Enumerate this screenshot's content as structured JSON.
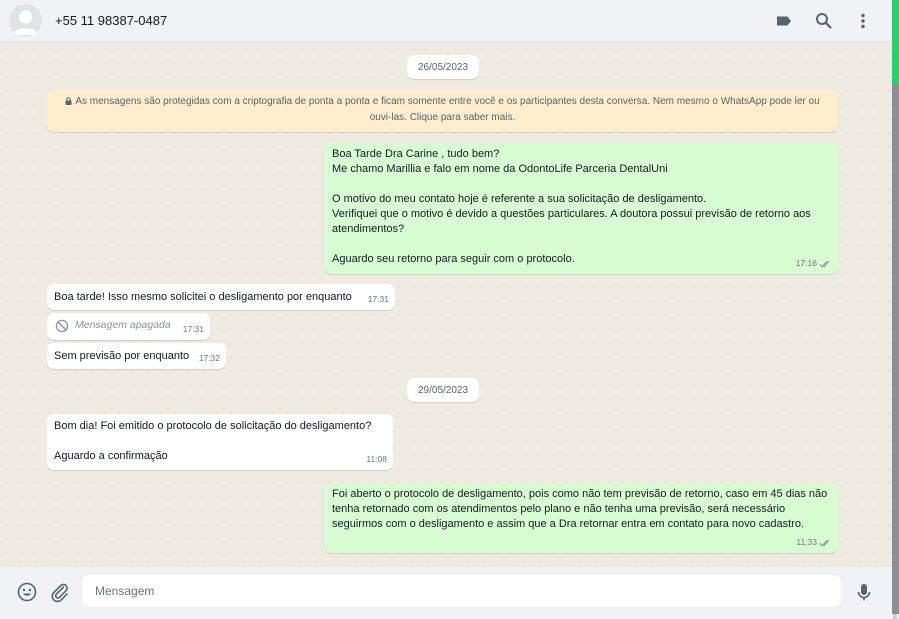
{
  "header": {
    "contact": "+55 11 98387-0487",
    "icons": [
      "label-icon",
      "search-icon",
      "menu-icon"
    ]
  },
  "chat": {
    "date1": "26/05/2023",
    "encryption_notice": "As mensagens são protegidas com a criptografia de ponta a ponta e ficam somente entre você e os participantes desta conversa. Nem mesmo o WhatsApp pode ler ou ouvi-las. Clique para saber mais.",
    "messages": [
      {
        "direction": "out",
        "text": "Boa Tarde Dra Carine , tudo bem?\nMe chamo Marillia e falo em nome da OdontoLife Parceria DentalUni\n\nO motivo do meu contato hoje é referente a sua solicitação de desligamento.\nVerifiquei que o motivo é devido a questões particulares. A doutora possui previsão de retorno aos atendimentos?\n\nAguardo seu retorno para seguir com o protocolo.",
        "time": "17:16",
        "status": "read"
      },
      {
        "direction": "in",
        "text": "Boa tarde! Isso mesmo solicitei o desligamento por enquanto",
        "time": "17:31"
      },
      {
        "direction": "in",
        "text": "Mensagem apagada",
        "time": "17:31",
        "deleted": true
      },
      {
        "direction": "in",
        "text": "Sem previsão por enquanto",
        "time": "17:32"
      },
      {
        "direction": "in",
        "text": "Bom dia! Foi emitido o protocolo de solicitação do desligamento?\n\nAguardo a confirmação",
        "time": "11:08"
      },
      {
        "direction": "out",
        "text": "Foi aberto o protocolo de desligamento, pois como não tem previsão de retorno, caso em 45 dias não tenha retornado com os atendimentos pelo plano e não tenha uma previsão, será necessário seguirmos com o desligamento e assim que a Dra retornar entra em contato para novo cadastro.",
        "time": "11:33",
        "status": "read"
      }
    ],
    "date2": "29/05/2023"
  },
  "footer": {
    "placeholder": "Mensagem",
    "icons": [
      "emoji-icon",
      "attach-icon",
      "mic-icon"
    ]
  },
  "colors": {
    "outgoing_bubble": "#d9fdd3",
    "incoming_bubble": "#ffffff",
    "chat_background": "#efeae2",
    "encryption_notice": "#ffeecd",
    "read_ticks": "#53bdeb",
    "accent": "#25d366"
  }
}
